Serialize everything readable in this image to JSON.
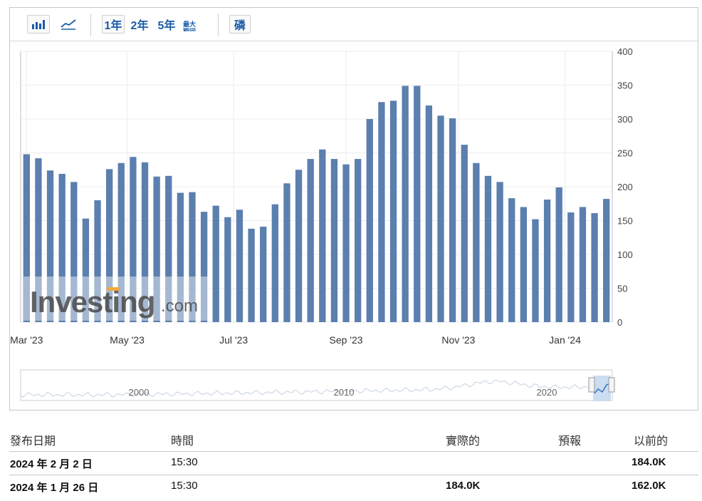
{
  "toolbar": {
    "period_buttons": [
      "1年",
      "2年",
      "5年"
    ],
    "max_label": "最大",
    "max_label_2": "期间",
    "extra_button": "磷",
    "bar_chart_icon": "bar-chart-icon",
    "line_chart_icon": "line-chart-icon"
  },
  "watermark": {
    "brand": "Investing",
    "suffix": ".com"
  },
  "chart_data": {
    "type": "bar",
    "color": "#5b7fae",
    "ylim": [
      0,
      400
    ],
    "y_ticks": [
      0,
      50,
      100,
      150,
      200,
      250,
      300,
      350,
      400
    ],
    "x_tick_labels": [
      "Mar '23",
      "May '23",
      "Jul '23",
      "Sep '23",
      "Nov '23",
      "Jan '24"
    ],
    "x_tick_bar_index": [
      0,
      8.5,
      17.5,
      27,
      36.5,
      45.5
    ],
    "values": [
      248,
      242,
      224,
      219,
      207,
      153,
      180,
      226,
      235,
      244,
      236,
      215,
      216,
      191,
      192,
      163,
      172,
      155,
      166,
      138,
      141,
      174,
      205,
      225,
      241,
      255,
      241,
      233,
      241,
      300,
      325,
      327,
      349,
      349,
      320,
      305,
      301,
      262,
      235,
      216,
      207,
      183,
      170,
      152,
      181,
      199,
      162,
      170,
      161,
      182
    ],
    "navigator_labels": [
      "2000",
      "2010",
      "2020"
    ]
  },
  "table": {
    "headers": {
      "date": "發布日期",
      "time": "時間",
      "actual": "實際的",
      "forecast": "預報",
      "previous": "以前的"
    },
    "rows": [
      {
        "date": "2024 年 2 月 2 日",
        "time": "15:30",
        "actual": "",
        "forecast": "",
        "previous": "184.0K"
      },
      {
        "date": "2024 年 1 月 26 日",
        "time": "15:30",
        "actual": "184.0K",
        "forecast": "",
        "previous": "162.0K"
      }
    ]
  }
}
